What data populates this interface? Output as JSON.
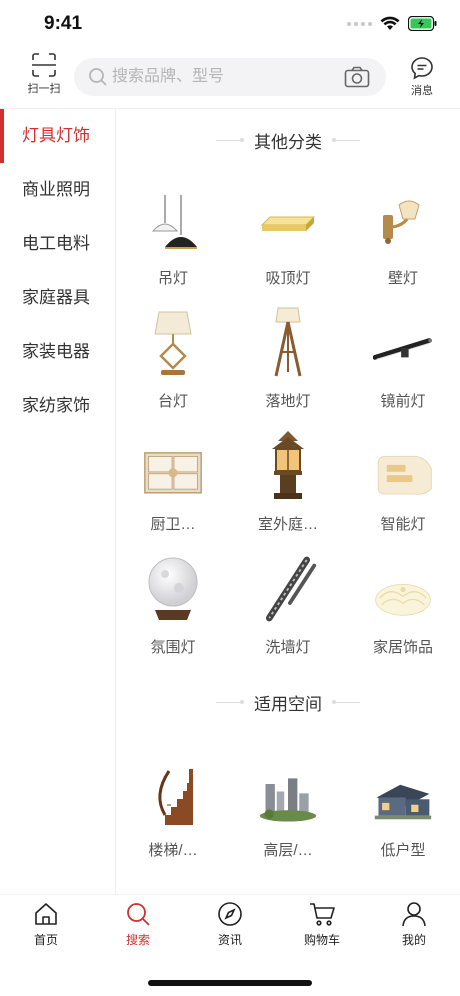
{
  "status": {
    "time": "9:41"
  },
  "header": {
    "scan_label": "扫一扫",
    "search_placeholder": "搜索品牌、型号",
    "message_label": "消息"
  },
  "sidebar": {
    "items": [
      {
        "label": "灯具灯饰",
        "active": true
      },
      {
        "label": "商业照明",
        "active": false
      },
      {
        "label": "电工电料",
        "active": false
      },
      {
        "label": "家庭器具",
        "active": false
      },
      {
        "label": "家装电器",
        "active": false
      },
      {
        "label": "家纺家饰",
        "active": false
      }
    ]
  },
  "sections": [
    {
      "title": "其他分类",
      "items": [
        {
          "label": "吊灯",
          "icon": "pendant-lamp-icon"
        },
        {
          "label": "吸顶灯",
          "icon": "ceiling-lamp-icon"
        },
        {
          "label": "壁灯",
          "icon": "wall-lamp-icon"
        },
        {
          "label": "台灯",
          "icon": "table-lamp-icon"
        },
        {
          "label": "落地灯",
          "icon": "floor-lamp-icon"
        },
        {
          "label": "镜前灯",
          "icon": "mirror-lamp-icon"
        },
        {
          "label": "厨卫…",
          "icon": "kitchen-bath-lamp-icon"
        },
        {
          "label": "室外庭…",
          "icon": "outdoor-lamp-icon"
        },
        {
          "label": "智能灯",
          "icon": "smart-lamp-icon"
        },
        {
          "label": "氛围灯",
          "icon": "ambient-lamp-icon"
        },
        {
          "label": "洗墙灯",
          "icon": "wall-washer-icon"
        },
        {
          "label": "家居饰品",
          "icon": "home-decor-icon"
        }
      ]
    },
    {
      "title": "适用空间",
      "items": [
        {
          "label": "楼梯/…",
          "icon": "staircase-icon"
        },
        {
          "label": "高层/…",
          "icon": "high-rise-icon"
        },
        {
          "label": "低户型",
          "icon": "low-rise-house-icon"
        }
      ]
    }
  ],
  "tabs": [
    {
      "label": "首页",
      "icon": "home-icon",
      "active": false
    },
    {
      "label": "搜索",
      "icon": "search-icon",
      "active": true
    },
    {
      "label": "资讯",
      "icon": "compass-icon",
      "active": false
    },
    {
      "label": "购物车",
      "icon": "cart-icon",
      "active": false
    },
    {
      "label": "我的",
      "icon": "profile-icon",
      "active": false
    }
  ],
  "colors": {
    "accent": "#d42e2e",
    "text": "#333333",
    "muted": "#555555"
  }
}
